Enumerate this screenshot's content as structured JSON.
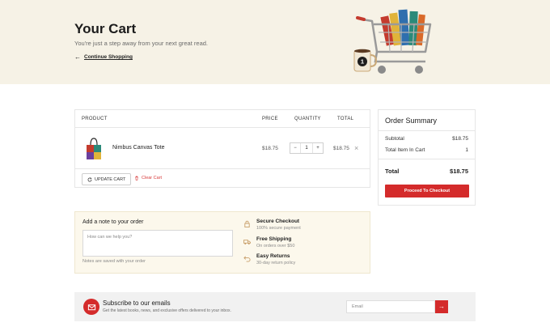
{
  "hero": {
    "title": "Your Cart",
    "subtitle": "You're just a step away from your next great read.",
    "back_arrow": "←",
    "back_label": "Continue Shopping",
    "cart_badge": "1"
  },
  "cart": {
    "headers": {
      "product": "PRODUCT",
      "price": "PRICE",
      "quantity": "QUANTITY",
      "total": "TOTAL"
    },
    "items": [
      {
        "name": "Nimbus Canvas Tote",
        "price": "$18.75",
        "quantity": "1",
        "total": "$18.75"
      }
    ],
    "qty_minus": "−",
    "qty_plus": "+",
    "remove_symbol": "×",
    "update_label": "UPDATE CART",
    "clear_label": "Clear Cart"
  },
  "summary": {
    "title": "Order Summary",
    "subtotal_label": "Subtotal",
    "subtotal_value": "$18.75",
    "items_label": "Total Item In Cart",
    "items_value": "1",
    "total_label": "Total",
    "total_value": "$18.75",
    "checkout_label": "Proceed To Checkout"
  },
  "note": {
    "label": "Add a note to your order",
    "placeholder": "How can we help you?",
    "hint": "Notes are saved with your order"
  },
  "perks": [
    {
      "icon": "lock-icon",
      "title": "Secure Checkout",
      "subtitle": "100% secure payment"
    },
    {
      "icon": "truck-icon",
      "title": "Free Shipping",
      "subtitle": "On orders over $50"
    },
    {
      "icon": "return-icon",
      "title": "Easy Returns",
      "subtitle": "30-day return policy"
    }
  ],
  "subscribe": {
    "title": "Subscribe to our emails",
    "description": "Get the latest books, news, and exclusive offers delivered to your inbox.",
    "email_placeholder": "Email",
    "submit_arrow": "→"
  },
  "colors": {
    "accent": "#d42b2b",
    "hero_bg": "#f6f2e6",
    "note_bg": "#fcf8ec",
    "perk_icon": "#c9a06b"
  }
}
